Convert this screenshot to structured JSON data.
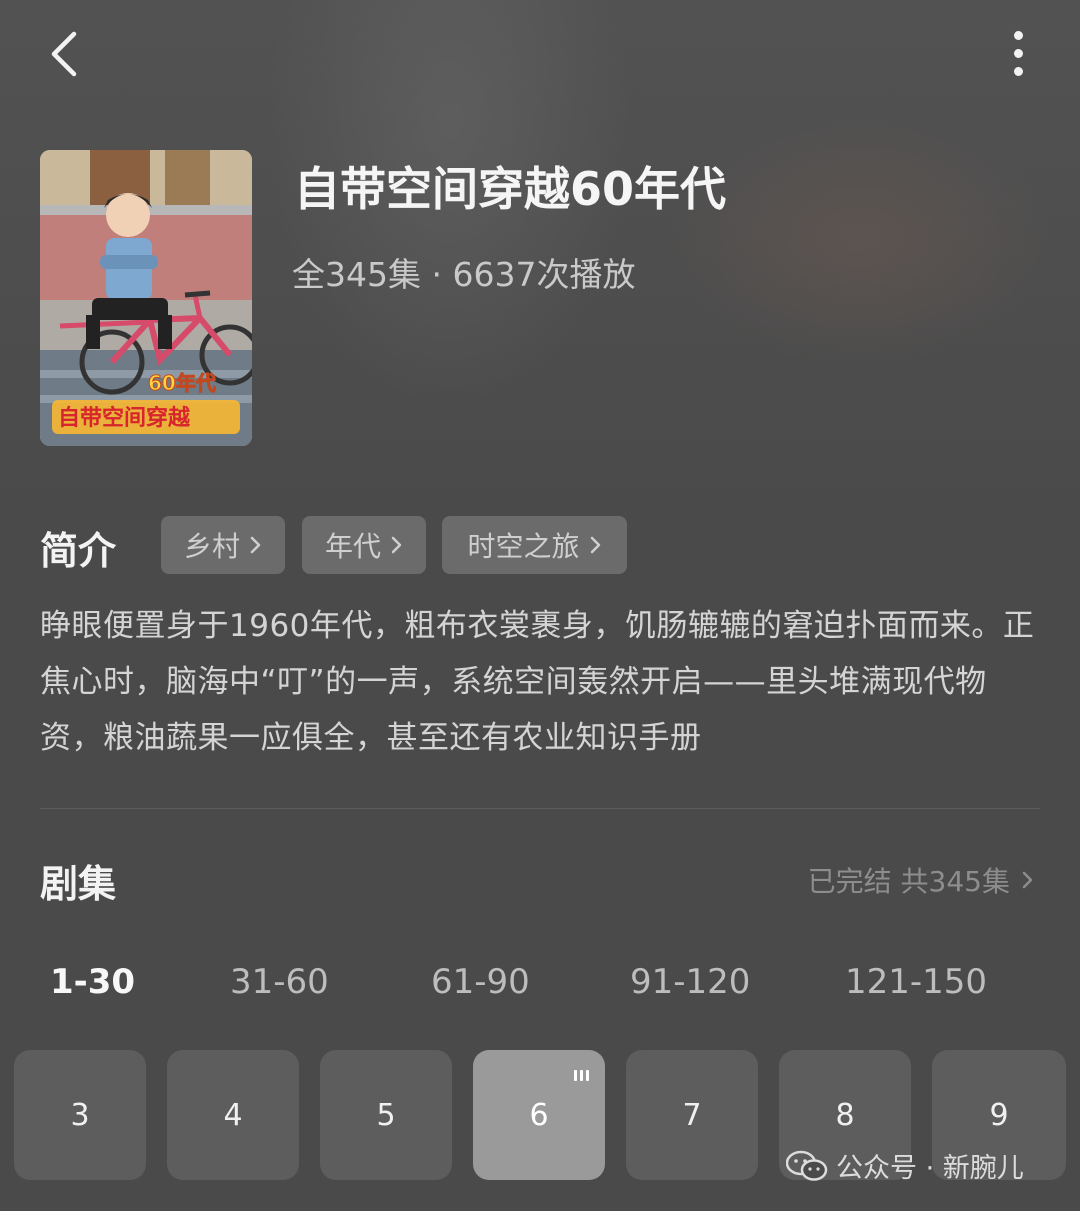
{
  "header": {
    "back_icon": "chevron-left-icon",
    "more_icon": "more-vertical-icon"
  },
  "drama": {
    "title": "自带空间穿越60年代",
    "meta": "全345集 · 6637次播放",
    "cover_text_top": "60年代",
    "cover_text_bottom": "自带空间穿越"
  },
  "intro": {
    "label": "简介",
    "tags": [
      "乡村",
      "年代",
      "时空之旅"
    ],
    "description": "睁眼便置身于1960年代，粗布衣裳裹身，饥肠辘辘的窘迫扑面而来。正焦心时，脑海中“叮”的一声，系统空间轰然开启——里头堆满现代物资，粮油蔬果一应俱全，甚至还有农业知识手册"
  },
  "episodes": {
    "label": "剧集",
    "status": "已完结 共345集",
    "ranges": [
      "1-30",
      "31-60",
      "61-90",
      "91-120",
      "121-150"
    ],
    "active_range": "1-30",
    "items": [
      "3",
      "4",
      "5",
      "6",
      "7",
      "8",
      "9"
    ],
    "current": "6"
  },
  "watermark": {
    "text": "公众号 · 新腕儿",
    "icon": "wechat-icon"
  },
  "colors": {
    "background": "#4a4a4a",
    "tag_bg": "#6b6b6b",
    "episode_bg": "#5d5d5d",
    "episode_current_bg": "#9a9a9a"
  }
}
